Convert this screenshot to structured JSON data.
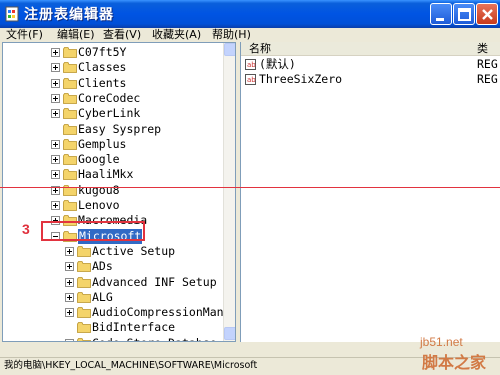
{
  "window": {
    "title": "注册表编辑器"
  },
  "menu": [
    "文件(F)",
    "编辑(E)",
    "查看(V)",
    "收藏夹(A)",
    "帮助(H)"
  ],
  "tree": [
    {
      "label": "C07ft5Y",
      "level": 0,
      "toggle": "plus"
    },
    {
      "label": "Classes",
      "level": 0,
      "toggle": "plus"
    },
    {
      "label": "Clients",
      "level": 0,
      "toggle": "plus"
    },
    {
      "label": "CoreCodec",
      "level": 0,
      "toggle": "plus"
    },
    {
      "label": "CyberLink",
      "level": 0,
      "toggle": "plus"
    },
    {
      "label": "Easy Sysprep",
      "level": 0,
      "toggle": "none"
    },
    {
      "label": "Gemplus",
      "level": 0,
      "toggle": "plus"
    },
    {
      "label": "Google",
      "level": 0,
      "toggle": "plus"
    },
    {
      "label": "HaaliMkx",
      "level": 0,
      "toggle": "plus"
    },
    {
      "label": "kugou8",
      "level": 0,
      "toggle": "plus"
    },
    {
      "label": "Lenovo",
      "level": 0,
      "toggle": "plus"
    },
    {
      "label": "Macromedia",
      "level": 0,
      "toggle": "plus"
    },
    {
      "label": "Microsoft",
      "level": 0,
      "toggle": "minus",
      "selected": true
    },
    {
      "label": "Active Setup",
      "level": 1,
      "toggle": "plus"
    },
    {
      "label": "ADs",
      "level": 1,
      "toggle": "plus"
    },
    {
      "label": "Advanced INF Setup",
      "level": 1,
      "toggle": "plus"
    },
    {
      "label": "ALG",
      "level": 1,
      "toggle": "plus"
    },
    {
      "label": "AudioCompressionMana",
      "level": 1,
      "toggle": "plus"
    },
    {
      "label": "BidInterface",
      "level": 1,
      "toggle": "none"
    },
    {
      "label": "Code Store Databse",
      "level": 1,
      "toggle": "plus"
    }
  ],
  "list": {
    "headers": [
      "名称",
      "类"
    ],
    "rows": [
      {
        "name": "(默认)",
        "type": "REG"
      },
      {
        "name": "ThreeSixZero",
        "type": "REG"
      }
    ]
  },
  "status": "我的电脑\\HKEY_LOCAL_MACHINE\\SOFTWARE\\Microsoft",
  "annotation": {
    "number": "3"
  },
  "watermark": {
    "line1": "jb51.net",
    "line2": "脚本之家"
  },
  "colors": {
    "titlebar": "#0054E3",
    "selection": "#316AC5",
    "annotation": "#E2333F"
  }
}
